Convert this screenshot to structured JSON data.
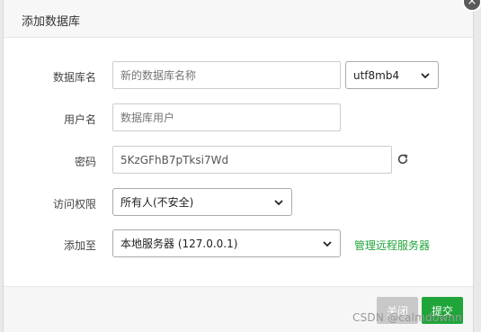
{
  "dialog": {
    "title": "添加数据库",
    "close_symbol": "×"
  },
  "form": {
    "db_name": {
      "label": "数据库名",
      "value": "",
      "placeholder": "新的数据库名称"
    },
    "charset": {
      "value": "utf8mb4"
    },
    "username": {
      "label": "用户名",
      "value": "",
      "placeholder": "数据库用户"
    },
    "password": {
      "label": "密码",
      "value": "5KzGFhB7pTksi7Wd"
    },
    "access": {
      "label": "访问权限",
      "value": "所有人(不安全)"
    },
    "add_to": {
      "label": "添加至",
      "value": "本地服务器 (127.0.0.1)",
      "manage_link": "管理远程服务器"
    }
  },
  "footer": {
    "close_label": "关闭",
    "submit_label": "提交"
  },
  "watermark": "CSDN @calmdownn",
  "colors": {
    "primary_green": "#20a53a",
    "disabled_gray": "#c8c8c8"
  }
}
